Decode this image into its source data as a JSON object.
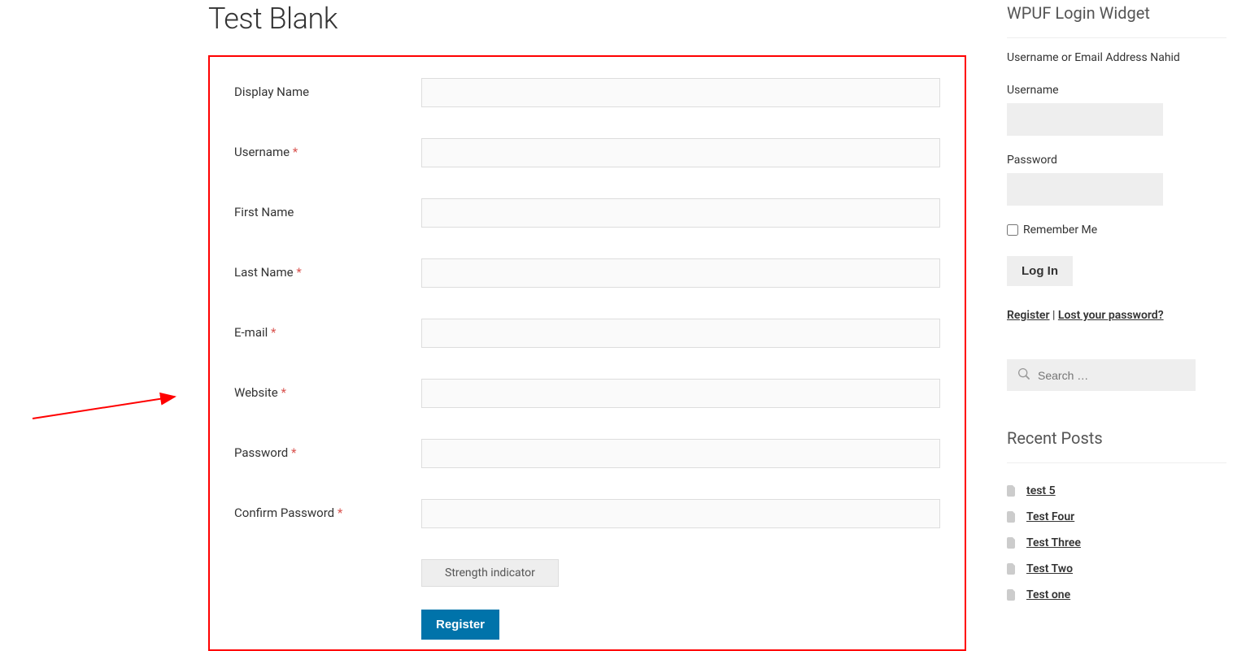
{
  "page": {
    "title": "Test Blank"
  },
  "form": {
    "fields": [
      {
        "label": "Display Name",
        "required": false
      },
      {
        "label": "Username",
        "required": true
      },
      {
        "label": "First Name",
        "required": false
      },
      {
        "label": "Last Name",
        "required": true
      },
      {
        "label": "E-mail",
        "required": true
      },
      {
        "label": "Website",
        "required": true
      },
      {
        "label": "Password",
        "required": true
      },
      {
        "label": "Confirm Password",
        "required": true
      }
    ],
    "strength_label": "Strength indicator",
    "submit_label": "Register"
  },
  "login_widget": {
    "title": "WPUF Login Widget",
    "desc": "Username or Email Address Nahid",
    "username_label": "Username",
    "password_label": "Password",
    "remember_label": "Remember Me",
    "login_label": "Log In",
    "register_link": "Register",
    "separator": " | ",
    "lost_link": "Lost your password?"
  },
  "search": {
    "placeholder": "Search …"
  },
  "recent": {
    "title": "Recent Posts",
    "items": [
      "test 5",
      "Test Four",
      "Test Three",
      "Test Two",
      "Test one"
    ]
  }
}
